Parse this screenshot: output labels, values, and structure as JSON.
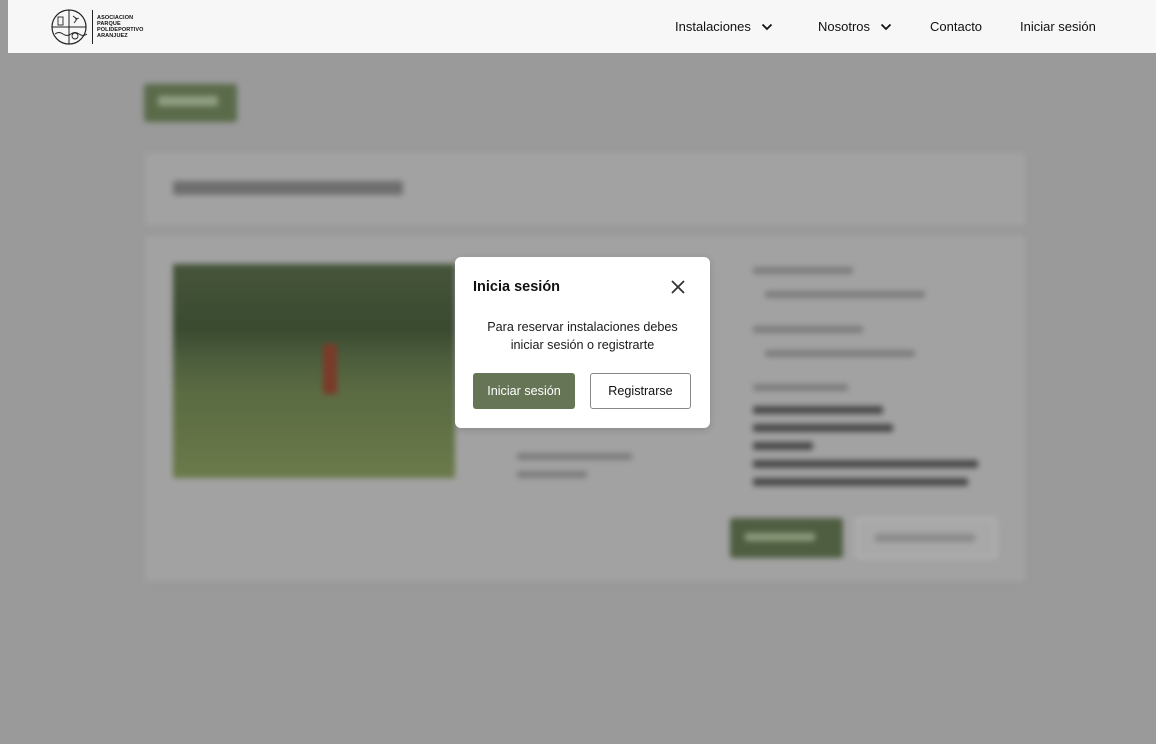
{
  "brand": {
    "name_lines": [
      "ASOCIACION",
      "PARQUE",
      "POLIDEPORTIVO",
      "ARANJUEZ"
    ]
  },
  "nav": {
    "instalaciones": "Instalaciones",
    "nosotros": "Nosotros",
    "contacto": "Contacto",
    "login": "Iniciar sesión"
  },
  "modal": {
    "title": "Inicia sesión",
    "message_line1": "Para reservar instalaciones debes",
    "message_line2": "iniciar sesión o registrarte",
    "login_button": "Iniciar sesión",
    "register_button": "Registrarse"
  },
  "colors": {
    "accent": "#667556",
    "overlay": "#9a9a9a"
  }
}
